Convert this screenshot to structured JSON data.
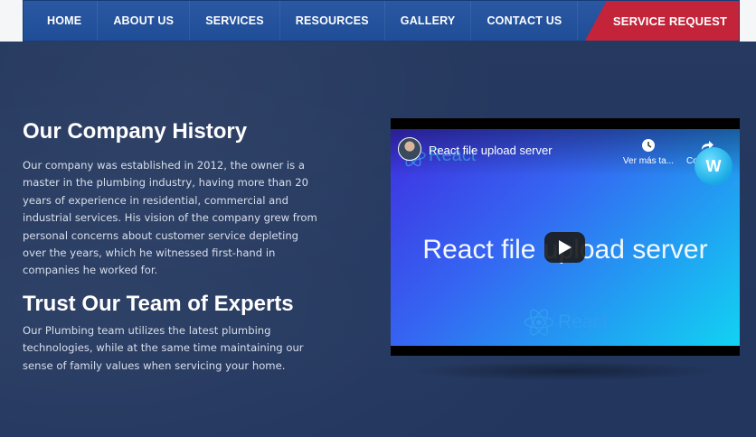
{
  "nav": {
    "items": [
      "HOME",
      "ABOUT US",
      "SERVICES",
      "RESOURCES",
      "GALLERY",
      "CONTACT US"
    ],
    "cta_label": "SERVICE REQUEST"
  },
  "history": {
    "title": "Our Company History",
    "text": "Our company was established in 2012, the owner is a master in the plumbing industry, having more than 20 years of experience in residential, commercial and industrial services. His vision of the company grew from personal concerns about customer service depleting over the years, which he witnessed first-hand in companies he worked for."
  },
  "experts": {
    "title": "Trust Our Team of Experts",
    "text": "Our Plumbing team utilizes the latest plumbing technologies, while at the same time maintaining our sense of family values when servicing your home."
  },
  "video": {
    "title": "React file upload server",
    "thumbnail_title": "React file upload server",
    "logo_text": "React",
    "watch_later_label": "Ver más ta...",
    "share_label": "Compartir",
    "watermark": "W",
    "colors": {
      "accent": "#c3243a",
      "nav": "#1f4d96",
      "bg": "#24375f"
    }
  }
}
